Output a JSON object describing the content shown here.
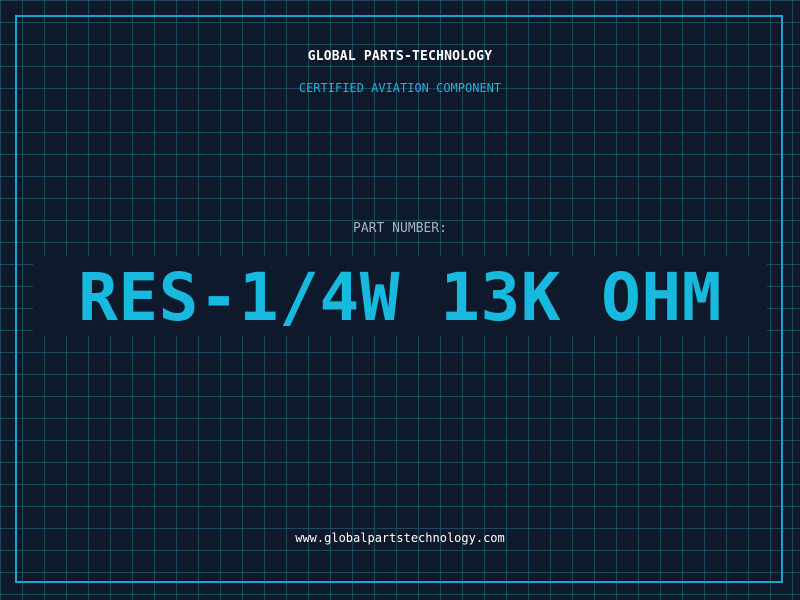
{
  "header": {
    "brand": "GLOBAL PARTS-TECHNOLOGY",
    "subtitle": "CERTIFIED AVIATION COMPONENT"
  },
  "part": {
    "label": "PART NUMBER:",
    "value": "RES-1/4W 13K OHM"
  },
  "footer": {
    "website": "www.globalpartstechnology.com"
  },
  "colors": {
    "background": "#0f192c",
    "grid": "#286e8c",
    "accent": "#17b9de",
    "frame": "#1fa3c9",
    "text": "#ffffff",
    "muted": "#a8b3c2"
  }
}
